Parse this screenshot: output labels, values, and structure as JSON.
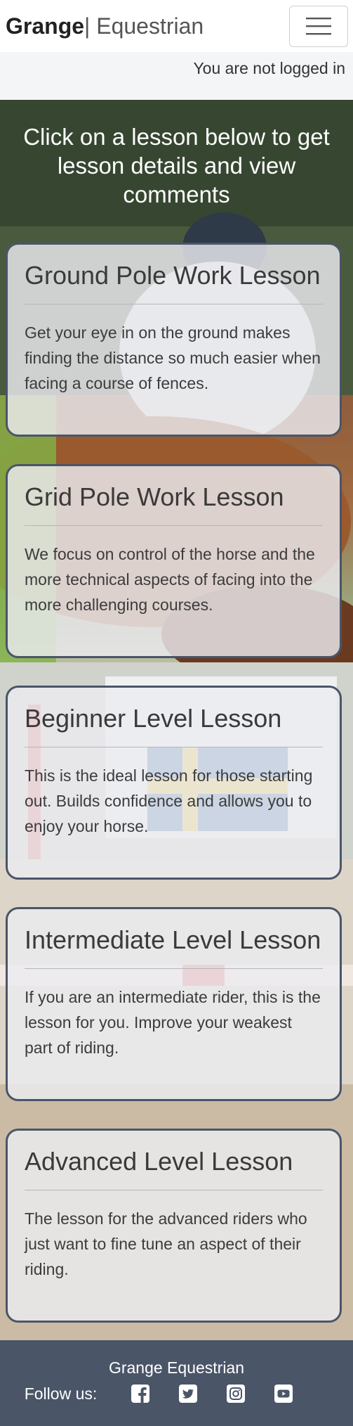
{
  "navbar": {
    "brand_bold": "Grange",
    "brand_sep": "|",
    "brand_light": " Equestrian",
    "menu_icon": "hamburger-menu-icon"
  },
  "status": {
    "login_text": "You are not logged in"
  },
  "hero": {
    "title": "Click on a lesson below to get lesson details and view comments"
  },
  "lessons": [
    {
      "title": "Ground Pole Work Lesson",
      "description": "Get your eye in on the ground makes finding the distance so much easier when facing a course of fences."
    },
    {
      "title": "Grid Pole Work Lesson",
      "description": "We focus on control of the horse and the more technical aspects of facing into the more challenging courses."
    },
    {
      "title": "Beginner Level Lesson",
      "description": "This is the ideal lesson for those starting out. Builds confidence and allows you to enjoy your horse."
    },
    {
      "title": "Intermediate Level Lesson",
      "description": "If you are an intermediate rider, this is the lesson for you. Improve your weakest part of riding."
    },
    {
      "title": "Advanced Level Lesson",
      "description": "The lesson for the advanced riders who just want to fine tune an aspect of their riding."
    }
  ],
  "footer": {
    "title": "Grange Equestrian",
    "follow_label": "Follow us:",
    "social_icons": [
      "facebook-icon",
      "twitter-icon",
      "instagram-icon",
      "youtube-icon"
    ]
  },
  "colors": {
    "card_border": "#4a5568",
    "footer_bg": "#4a5568"
  }
}
